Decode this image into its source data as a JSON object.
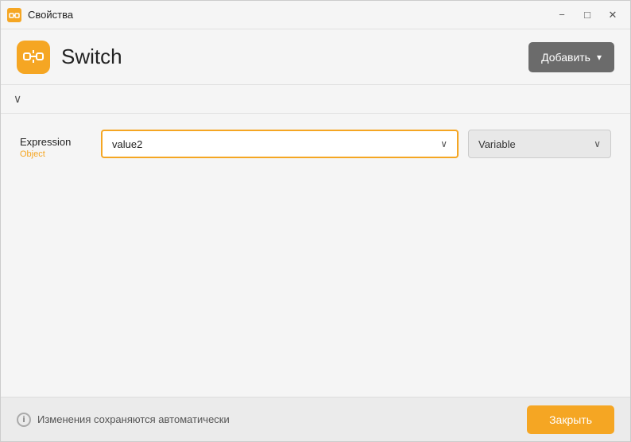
{
  "titlebar": {
    "icon_label": "app-icon",
    "title": "Свойства"
  },
  "header": {
    "title": "Switch",
    "add_button_label": "Добавить",
    "add_button_chevron": "▾"
  },
  "collapse": {
    "chevron": "∨"
  },
  "expression": {
    "label": "Expression",
    "sublabel": "Object",
    "value": "value2",
    "chevron": "∨"
  },
  "variable": {
    "label": "Variable",
    "chevron": "∨"
  },
  "footer": {
    "info_text": "Изменения сохраняются автоматически",
    "close_button_label": "Закрыть"
  },
  "colors": {
    "accent": "#f5a623",
    "button_dark": "#6b6b6b",
    "footer_bg": "#ebebeb"
  }
}
